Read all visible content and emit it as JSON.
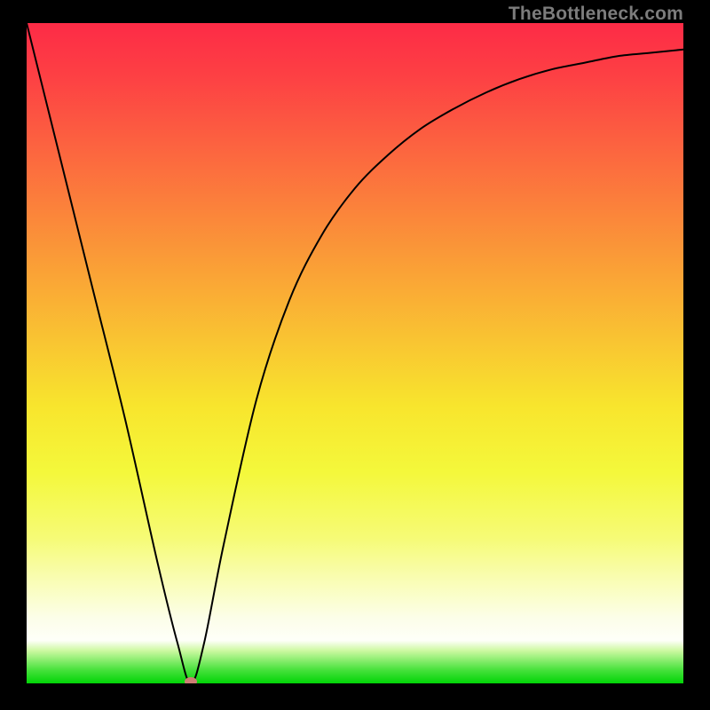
{
  "watermark": "TheBottleneck.com",
  "chart_data": {
    "type": "line",
    "title": "",
    "xlabel": "",
    "ylabel": "",
    "xlim": [
      0,
      1
    ],
    "ylim": [
      0,
      1
    ],
    "background_gradient": {
      "direction": "vertical",
      "stops": [
        {
          "pos": 0.0,
          "color": "#fd2b46"
        },
        {
          "pos": 0.5,
          "color": "#f9c432"
        },
        {
          "pos": 0.8,
          "color": "#f6fb76"
        },
        {
          "pos": 0.95,
          "color": "#cef9a3"
        },
        {
          "pos": 1.0,
          "color": "#02d507"
        }
      ]
    },
    "series": [
      {
        "name": "curve",
        "color": "#000000",
        "x": [
          0.0,
          0.05,
          0.1,
          0.15,
          0.2,
          0.23,
          0.25,
          0.27,
          0.3,
          0.35,
          0.4,
          0.45,
          0.5,
          0.55,
          0.6,
          0.65,
          0.7,
          0.75,
          0.8,
          0.85,
          0.9,
          0.95,
          1.0
        ],
        "y": [
          1.0,
          0.8,
          0.6,
          0.4,
          0.18,
          0.06,
          0.0,
          0.06,
          0.21,
          0.43,
          0.58,
          0.68,
          0.75,
          0.8,
          0.84,
          0.87,
          0.895,
          0.915,
          0.93,
          0.94,
          0.95,
          0.955,
          0.96
        ]
      }
    ],
    "marker": {
      "x": 0.25,
      "y": 0.0,
      "color": "#cd7e74"
    }
  }
}
